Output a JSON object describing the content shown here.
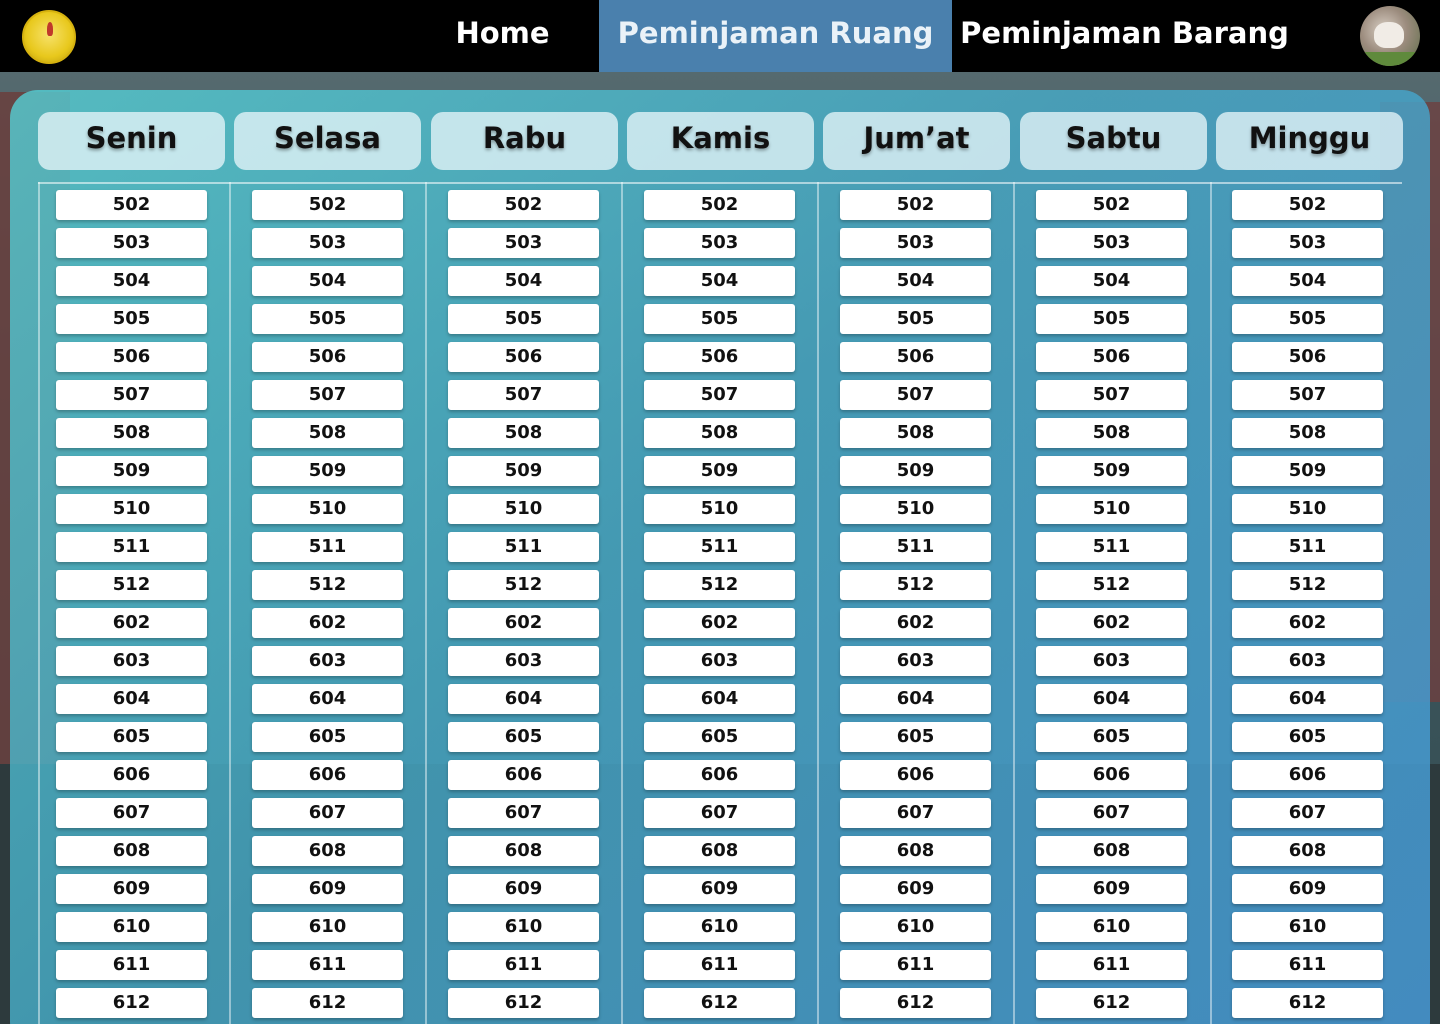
{
  "nav": {
    "home": "Home",
    "ruang": "Peminjaman Ruang",
    "barang": "Peminjaman Barang",
    "active": "Peminjaman Ruang",
    "active_color": "#4a80ad"
  },
  "days": [
    "Senin",
    "Selasa",
    "Rabu",
    "Kamis",
    "Jum’at",
    "Sabtu",
    "Minggu"
  ],
  "rooms": [
    "502",
    "503",
    "504",
    "505",
    "506",
    "507",
    "508",
    "509",
    "510",
    "511",
    "512",
    "602",
    "603",
    "604",
    "605",
    "606",
    "607",
    "608",
    "609",
    "610",
    "611",
    "612"
  ],
  "icons": {
    "logo": "university-logo-icon",
    "avatar": "user-avatar-icon"
  }
}
